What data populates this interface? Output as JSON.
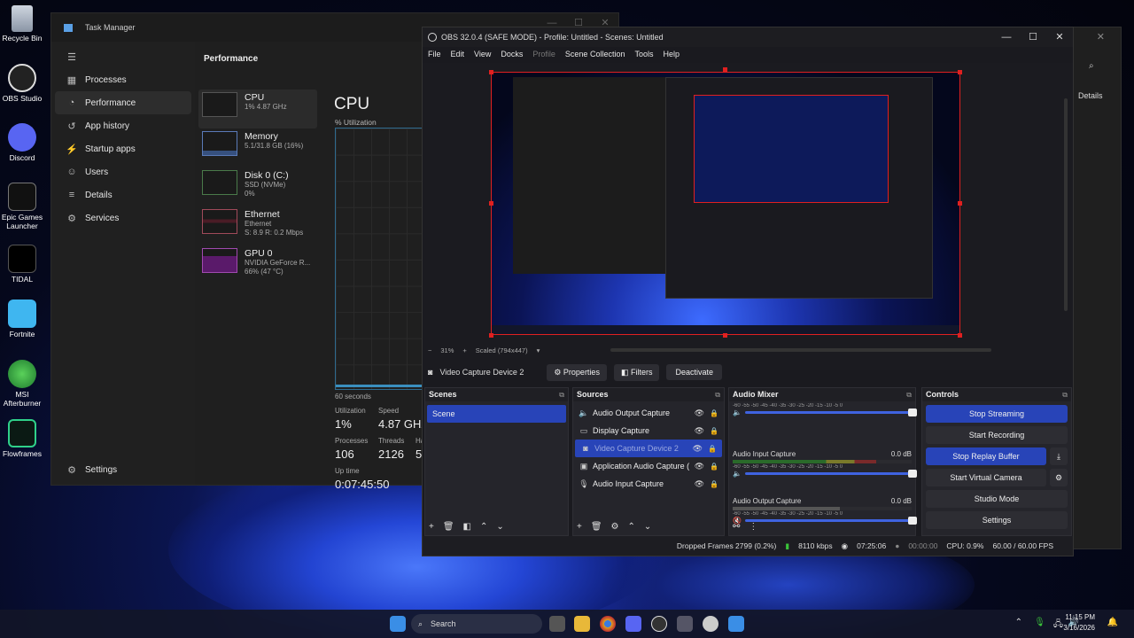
{
  "desktop": {
    "icons": [
      {
        "label": "Recycle Bin",
        "icon": "recycle-bin-icon"
      },
      {
        "label": "OBS Studio",
        "icon": "obs-icon"
      },
      {
        "label": "Discord",
        "icon": "discord-icon"
      },
      {
        "label": "Epic Games Launcher",
        "icon": "epic-games-icon"
      },
      {
        "label": "TIDAL",
        "icon": "tidal-icon"
      },
      {
        "label": "Fortnite",
        "icon": "fortnite-icon"
      },
      {
        "label": "MSI Afterburner",
        "icon": "msi-afterburner-icon"
      },
      {
        "label": "Flowframes",
        "icon": "flowframes-icon"
      }
    ]
  },
  "task_manager": {
    "title": "Task Manager",
    "nav": [
      "Processes",
      "Performance",
      "App history",
      "Startup apps",
      "Users",
      "Details",
      "Services"
    ],
    "settings": "Settings",
    "header": "Performance",
    "items": [
      {
        "name": "CPU",
        "sub": "1% 4.87 GHz"
      },
      {
        "name": "Memory",
        "sub": "5.1/31.8 GB (16%)"
      },
      {
        "name": "Disk 0 (C:)",
        "sub": "SSD (NVMe)",
        "sub2": "0%"
      },
      {
        "name": "Ethernet",
        "sub": "Ethernet",
        "sub2": "S: 8.9 R: 0.2 Mbps"
      },
      {
        "name": "GPU 0",
        "sub": "NVIDIA GeForce R...",
        "sub2": "66% (47 °C)"
      }
    ],
    "cpu_title": "CPU",
    "util_label": "% Utilization",
    "seconds": "60 seconds",
    "stats": {
      "utilization_label": "Utilization",
      "utilization": "1%",
      "speed_label": "Speed",
      "speed": "4.87 GHz",
      "processes_label": "Processes",
      "processes": "106",
      "threads_label": "Threads",
      "threads": "2126",
      "handles_label": "Ha",
      "handles": "5",
      "uptime_label": "Up time",
      "uptime": "0:07:45:50"
    }
  },
  "right_window": {
    "details": "Details"
  },
  "obs": {
    "title": "OBS 32.0.4 (SAFE MODE) - Profile: Untitled - Scenes: Untitled",
    "menu": [
      "File",
      "Edit",
      "View",
      "Docks",
      "Profile",
      "Scene Collection",
      "Tools",
      "Help"
    ],
    "zoom": "31%",
    "scaled": "Scaled (794x447)",
    "source_name": "Video Capture Device 2",
    "properties": "Properties",
    "filters": "Filters",
    "deactivate": "Deactivate",
    "scenes_title": "Scenes",
    "scenes": [
      "Scene"
    ],
    "sources_title": "Sources",
    "sources": [
      {
        "name": "Audio Output Capture",
        "icon": "speaker-icon"
      },
      {
        "name": "Display Capture",
        "icon": "monitor-icon"
      },
      {
        "name": "Video Capture Device 2",
        "icon": "camera-icon"
      },
      {
        "name": "Application Audio Capture (",
        "icon": "app-audio-icon"
      },
      {
        "name": "Audio Input Capture",
        "icon": "mic-icon"
      }
    ],
    "mixer_title": "Audio Mixer",
    "mixer": [
      {
        "name": "",
        "db": ""
      },
      {
        "name": "Audio Input Capture",
        "db": "0.0 dB"
      },
      {
        "name": "Audio Output Capture",
        "db": "0.0 dB"
      }
    ],
    "mixer_ticks": "-60 -55 -50 -45 -40 -35 -30 -25 -20 -15 -10 -5 0",
    "controls_title": "Controls",
    "controls": {
      "stop_streaming": "Stop Streaming",
      "start_recording": "Start Recording",
      "stop_replay": "Stop Replay Buffer",
      "virtual_camera": "Start Virtual Camera",
      "studio_mode": "Studio Mode",
      "settings": "Settings"
    },
    "status": {
      "dropped": "Dropped Frames 2799 (0.2%)",
      "kbps": "8110 kbps",
      "stream_time": "07:25:06",
      "rec_time": "00:00:00",
      "cpu": "CPU: 0.9%",
      "fps": "60.00 / 60.00 FPS"
    }
  },
  "taskbar": {
    "search": "Search",
    "time": "11:15 PM",
    "date": "3/16/2026"
  },
  "colors": {
    "accent": "#2844b8",
    "selection_red": "#e02020"
  }
}
